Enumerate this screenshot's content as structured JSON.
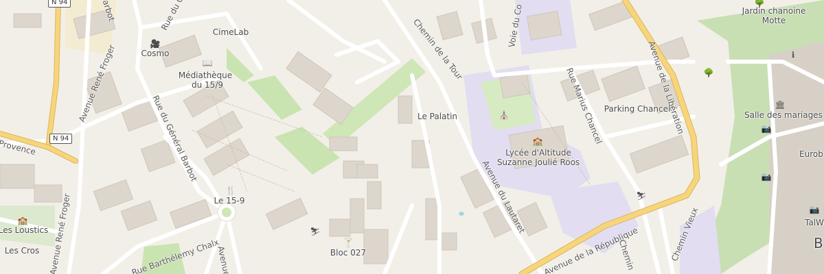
{
  "roads": {
    "n94_a": "N 94",
    "n94_b": "N 94",
    "rue_du_general_barbot": "Rue du Général Barbot",
    "rue_du_general_barbot_top": "arbot",
    "rue_du_c": "Rue du C",
    "avenue_rene_froger_top": "Avenue René Froger",
    "avenue_rene_froger_bottom": "Avenue René Froger",
    "provence": "Provence",
    "rue_barthelemy_chalx": "Rue Barthélemy Chalx",
    "avenue_bottom": "Avenue",
    "chemin_de_la_tour": "Chemin de la Tour",
    "voie_du_co": "Voie du Co",
    "avenue_de_la_liberation": "Avenue de la Libération",
    "rue_marius_chancel": "Rue Marius Chancel",
    "avenue_du_lautaret": "Avenue du Lautaret",
    "avenue_de_la_republique": "Avenue de la République",
    "chemin_vieux": "Chemin Vieux",
    "chemin_bottom": "Chemin"
  },
  "places": {
    "cimelab": "CimeLab",
    "cosmo": "Cosmo",
    "mediatheque": "Médiathèque",
    "mediatheque_sub": "du 15/9",
    "le_15_9": "Le 15-9",
    "les_loustics": "Les Loustics",
    "les_cros": "Les Cros",
    "bloc_027": "Bloc 027",
    "le_palatin": "Le Palatin",
    "lycee": "Lycée d'Altitude",
    "lycee_sub": "Suzanne Joulié Roos",
    "parking_chancel": "Parking Chancel",
    "jardin": "Jardin chanoine",
    "jardin_sub": "Motte",
    "salle_des_mariages": "Salle des mariages",
    "eurob": "Eurob",
    "talwe": "TalWe",
    "b_letter": "B"
  },
  "icons": {
    "cinema": "cinema-icon",
    "library": "library-icon",
    "restaurant": "restaurant-icon",
    "school": "school-icon",
    "playground": "playground-icon",
    "bar": "bar-icon",
    "church": "church-icon",
    "tree": "tree-icon",
    "museum": "museum-icon",
    "info": "information-icon",
    "camera": "camera-icon"
  },
  "colors": {
    "background": "#f2efe9",
    "building": "#ddd6cc",
    "road": "#ffffff",
    "primary_road": "#f7d57a",
    "park": "#c9e4b0",
    "school_area": "#e2ddf1",
    "forest": "#b9d7a0"
  }
}
